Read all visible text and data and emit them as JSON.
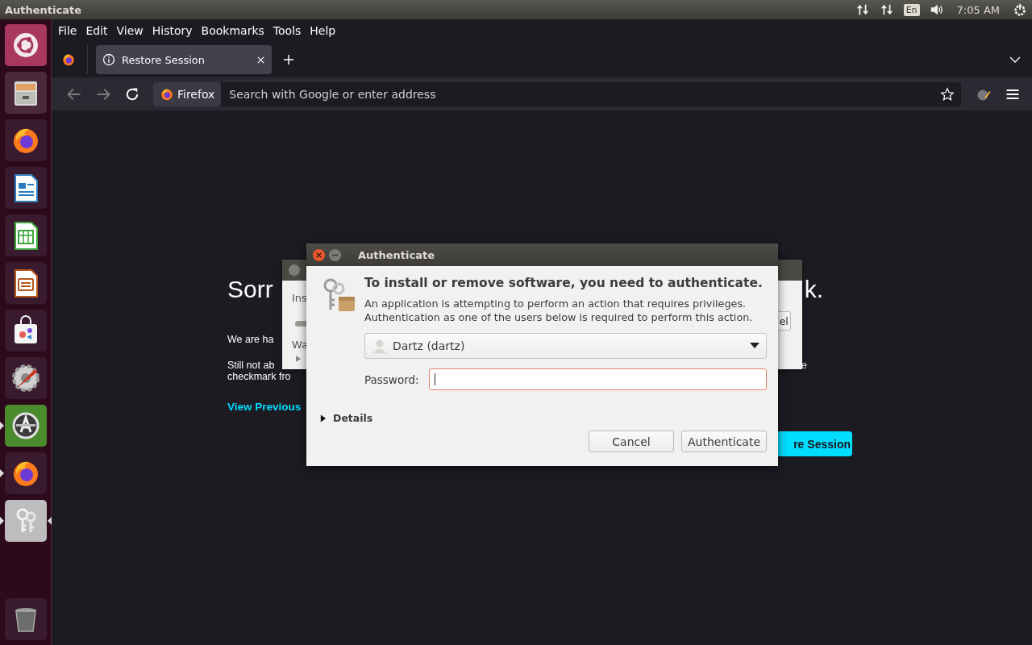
{
  "top_panel": {
    "title": "Authenticate",
    "keyboard_layout": "En",
    "clock": "7:05 AM"
  },
  "launcher": {
    "items": [
      {
        "kind": "ubuntu",
        "running": false,
        "focused": false
      },
      {
        "kind": "files",
        "running": false,
        "focused": false
      },
      {
        "kind": "firefox",
        "running": false,
        "focused": false
      },
      {
        "kind": "writer",
        "running": false,
        "focused": false
      },
      {
        "kind": "calc",
        "running": false,
        "focused": false
      },
      {
        "kind": "impress",
        "running": false,
        "focused": false
      },
      {
        "kind": "software",
        "running": false,
        "focused": false
      },
      {
        "kind": "settings",
        "running": false,
        "focused": false
      },
      {
        "kind": "updater",
        "running": true,
        "focused": false
      },
      {
        "kind": "firefox",
        "running": true,
        "focused": false
      },
      {
        "kind": "keys",
        "running": true,
        "focused": true
      }
    ],
    "trash": {
      "kind": "trash"
    }
  },
  "browser": {
    "menu": [
      "File",
      "Edit",
      "View",
      "History",
      "Bookmarks",
      "Tools",
      "Help"
    ],
    "tabs": [
      {
        "label": "Restore Session",
        "selected": true
      }
    ],
    "identity": "Firefox",
    "address_placeholder": "Search with Google or enter address"
  },
  "page": {
    "heading_start": "Sorr",
    "heading_end": "k.",
    "line_1": "We are ha",
    "line_2": "Still not ab",
    "line_2_end": "e",
    "line_3": "checkmark fro",
    "link": "View Previous",
    "button": "re Session"
  },
  "background_dialog": {
    "label_1": "Ins",
    "label_2": "Wa",
    "button": "el"
  },
  "dialog": {
    "title": "Authenticate",
    "heading": "To install or remove software, you need to authenticate.",
    "message": [
      "An application is attempting to perform an action that requires privileges.",
      "Authentication as one of the users below is required to perform this action."
    ],
    "user": "Dartz (dartz)",
    "password_label": "Password:",
    "details": "Details",
    "details_expanded": false,
    "buttons": [
      "Cancel",
      "Authenticate"
    ]
  }
}
